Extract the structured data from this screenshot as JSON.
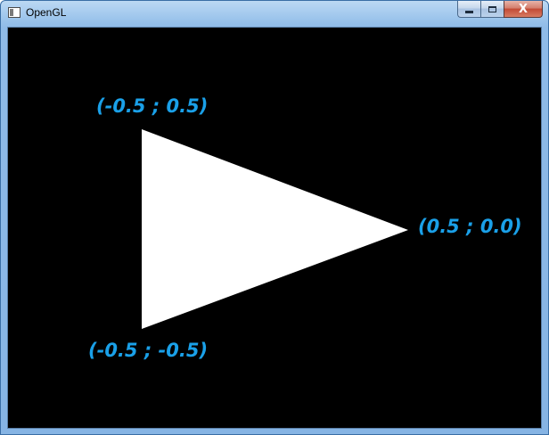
{
  "window": {
    "title": "OpenGL",
    "icon": "window-app-icon",
    "controls": {
      "minimize_icon": "minimize-icon",
      "maximize_icon": "maximize-icon",
      "close_label": "X"
    }
  },
  "canvas": {
    "background": "#000000",
    "triangle_color": "#ffffff",
    "label_color": "#1aa0e8",
    "vertices": [
      {
        "label": "(-0.5 ; 0.5)"
      },
      {
        "label": "(0.5 ; 0.0)"
      },
      {
        "label": "(-0.5 ; -0.5)"
      }
    ]
  }
}
